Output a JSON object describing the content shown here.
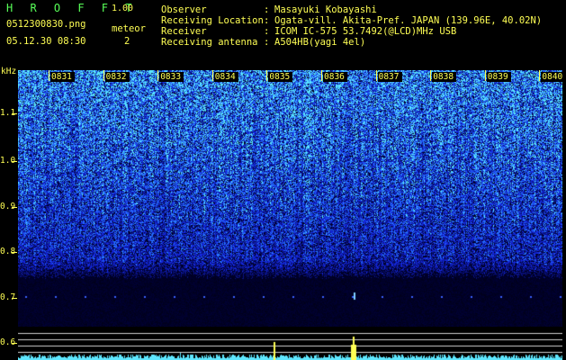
{
  "app": {
    "name": "H R O F F T",
    "version": "1.00"
  },
  "file": {
    "name": "0512300830.png",
    "datetime": "05.12.30 08:30"
  },
  "meteor": {
    "label": "meteor",
    "count": "2"
  },
  "info": [
    {
      "label": "Observer",
      "value": "Masayuki Kobayashi"
    },
    {
      "label": "Receiving Location",
      "value": "Ogata-vill. Akita-Pref. JAPAN (139.96E, 40.02N)"
    },
    {
      "label": "Receiver",
      "value": "ICOM IC-575 53.7492(@LCD)MHz USB"
    },
    {
      "label": "Receiving antenna",
      "value": "A504HB(yagi 4el)"
    }
  ],
  "axis": {
    "y_unit": "kHz",
    "y_ticks": [
      "1.1",
      "1.0",
      "0.9",
      "0.8",
      "0.7",
      "0.6"
    ],
    "x_ticks": [
      "0831",
      "0832",
      "0833",
      "0834",
      "0835",
      "0836",
      "0837",
      "0838",
      "0839",
      "0840"
    ]
  },
  "colors": {
    "label_yellow": "#ffff54",
    "title_green": "#58ff58",
    "spectrum_blue": "#1a2cff",
    "spectrum_cyan": "#5ee7ff"
  }
}
